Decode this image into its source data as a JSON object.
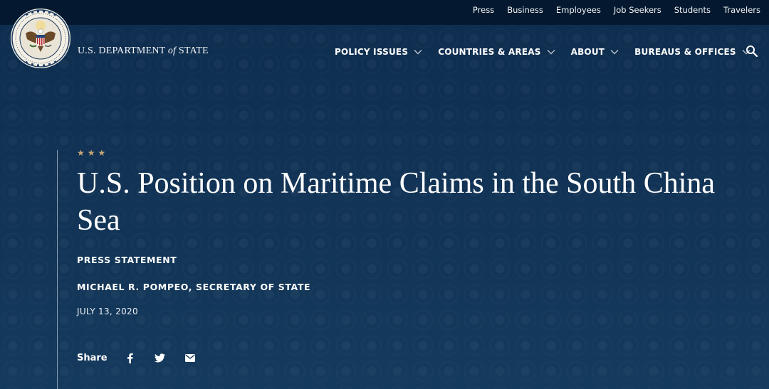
{
  "utility_nav": [
    "Press",
    "Business",
    "Employees",
    "Job Seekers",
    "Students",
    "Travelers"
  ],
  "brand": {
    "prefix": "U.S. DEPARTMENT",
    "of": "of",
    "suffix": "STATE",
    "seal_text": "DEPARTMENT OF STATE · UNITED STATES OF AMERICA"
  },
  "main_nav": [
    "POLICY ISSUES",
    "COUNTRIES & AREAS",
    "ABOUT",
    "BUREAUS & OFFICES"
  ],
  "hero": {
    "stars": "★★★",
    "title": "U.S. Position on Maritime Claims in the South China Sea",
    "doc_type": "PRESS STATEMENT",
    "author": "MICHAEL R. POMPEO, SECRETARY OF STATE",
    "date": "JULY 13, 2020"
  },
  "share": {
    "label": "Share",
    "icons": [
      "facebook-icon",
      "twitter-icon",
      "email-icon"
    ]
  },
  "colors": {
    "utility_bar": "#04192f",
    "hero_bg": "#123456",
    "star_gold": "#c5a576",
    "rule": "#8c9db0"
  }
}
